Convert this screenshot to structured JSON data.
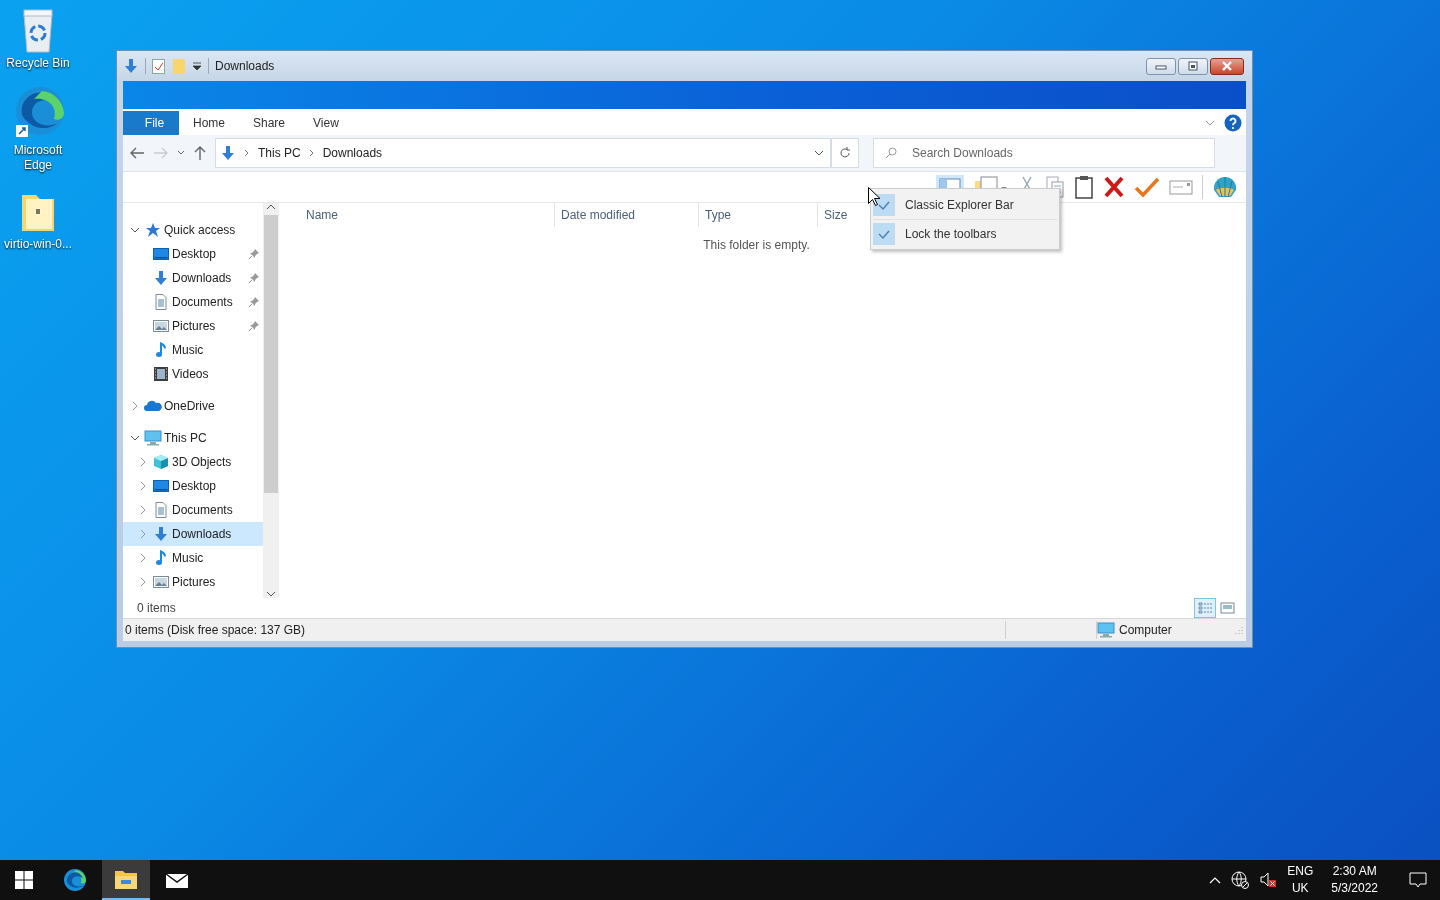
{
  "desktop_icons": [
    {
      "label": "Recycle Bin",
      "kind": "recycle"
    },
    {
      "label": "Microsoft Edge",
      "kind": "edge"
    },
    {
      "label": "virtio-win-0...",
      "kind": "folder"
    }
  ],
  "window": {
    "title": "Downloads"
  },
  "ribbon_tabs": [
    {
      "label": "File",
      "selected": true
    },
    {
      "label": "Home",
      "selected": false
    },
    {
      "label": "Share",
      "selected": false
    },
    {
      "label": "View",
      "selected": false
    }
  ],
  "address_bar": {
    "breadcrumbs": [
      "This PC",
      "Downloads"
    ]
  },
  "search": {
    "placeholder": "Search Downloads"
  },
  "toolbar_menu": {
    "items": [
      {
        "label": "Classic Explorer Bar",
        "checked": true
      },
      {
        "label": "Lock the toolbars",
        "checked": true
      }
    ]
  },
  "navigation": {
    "items": [
      {
        "label": "Quick access",
        "kind": "star",
        "expanded": true,
        "selected": false,
        "children": [
          {
            "label": "Desktop",
            "kind": "desktop",
            "pinned": true,
            "selected": false
          },
          {
            "label": "Downloads",
            "kind": "download",
            "pinned": true,
            "selected": false
          },
          {
            "label": "Documents",
            "kind": "documents",
            "pinned": true,
            "selected": false
          },
          {
            "label": "Pictures",
            "kind": "pictures",
            "pinned": true,
            "selected": false
          },
          {
            "label": "Music",
            "kind": "music",
            "pinned": false,
            "selected": false
          },
          {
            "label": "Videos",
            "kind": "videos",
            "pinned": false,
            "selected": false
          }
        ]
      },
      {
        "label": "OneDrive",
        "kind": "onedrive",
        "expanded": false,
        "selected": false
      },
      {
        "label": "This PC",
        "kind": "pc",
        "expanded": true,
        "selected": false,
        "children": [
          {
            "label": "3D Objects",
            "kind": "cube",
            "expanded": false,
            "selected": false
          },
          {
            "label": "Desktop",
            "kind": "desktop",
            "expanded": false,
            "selected": false
          },
          {
            "label": "Documents",
            "kind": "documents",
            "expanded": false,
            "selected": false
          },
          {
            "label": "Downloads",
            "kind": "download",
            "expanded": false,
            "selected": true
          },
          {
            "label": "Music",
            "kind": "music",
            "expanded": false,
            "selected": false
          },
          {
            "label": "Pictures",
            "kind": "pictures",
            "expanded": false,
            "selected": false
          }
        ]
      }
    ]
  },
  "file_list": {
    "columns": [
      "Name",
      "Date modified",
      "Type",
      "Size"
    ],
    "empty_message": "This folder is empty."
  },
  "item_count": "0 items",
  "view_buttons": [
    {
      "kind": "details",
      "selected": true
    },
    {
      "kind": "thumbnails",
      "selected": false
    }
  ],
  "status_bar": {
    "text": "0 items (Disk free space: 137 GB)",
    "location": "Computer"
  },
  "taskbar": {
    "apps": [
      {
        "kind": "edge",
        "selected": false
      },
      {
        "kind": "explorer",
        "selected": true
      },
      {
        "kind": "mail",
        "selected": false
      }
    ],
    "language": [
      "ENG",
      "UK"
    ],
    "time": "2:30 AM",
    "date": "5/3/2022"
  }
}
